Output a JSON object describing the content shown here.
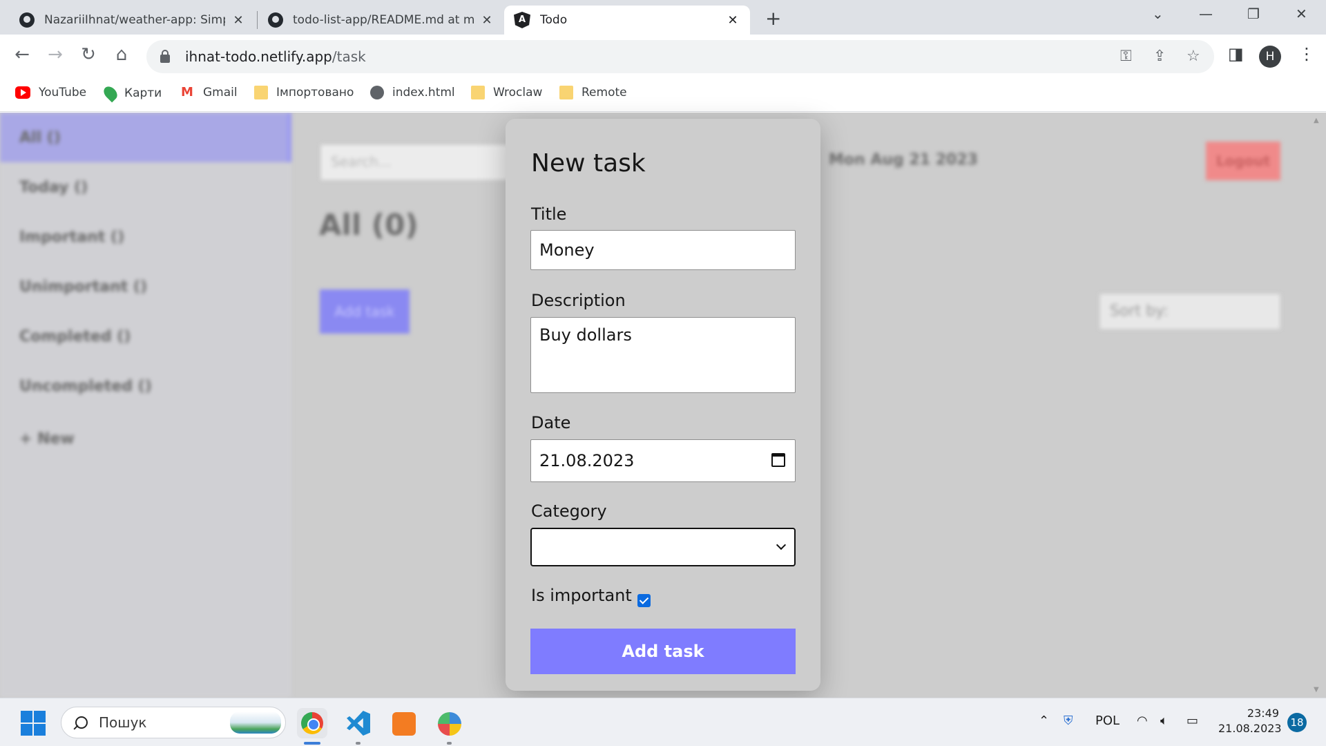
{
  "browser": {
    "tabs": [
      {
        "title": "NazariiIhnat/weather-app: Simple",
        "close": "✕"
      },
      {
        "title": "todo-list-app/README.md at ma",
        "close": "✕"
      },
      {
        "title": "Todo",
        "close": "✕"
      }
    ],
    "new_tab": "+",
    "url_host": "ihnat-todo.netlify.app",
    "url_path": "/task",
    "profile_initial": "H",
    "bookmarks": [
      "YouTube",
      "Карти",
      "Gmail",
      "Імпортовано",
      "index.html",
      "Wroclaw",
      "Remote"
    ]
  },
  "sidebar": {
    "items": [
      "All ()",
      "Today ()",
      "Important ()",
      "Unimportant ()",
      "Completed ()",
      "Uncompleted ()",
      "+ New"
    ]
  },
  "main": {
    "search_placeholder": "Search...",
    "heading": "All (0)",
    "add_task_label": "Add task",
    "date": "Mon Aug 21 2023",
    "logout_label": "Logout",
    "sort_label": "Sort by:"
  },
  "modal": {
    "title": "New task",
    "title_label": "Title",
    "title_value": "Money",
    "description_label": "Description",
    "description_value": "Buy dollars",
    "date_label": "Date",
    "date_value": "21.08.2023",
    "category_label": "Category",
    "category_value": "",
    "important_label": "Is important",
    "important_checked": true,
    "submit_label": "Add task"
  },
  "taskbar": {
    "search_placeholder": "Пошук",
    "language": "POL",
    "time": "23:49",
    "date": "21.08.2023",
    "notifications": "18"
  },
  "colors": {
    "accent": "#7f7cff",
    "logout": "#f08a8a",
    "modal_bg": "#cdcdcd"
  }
}
